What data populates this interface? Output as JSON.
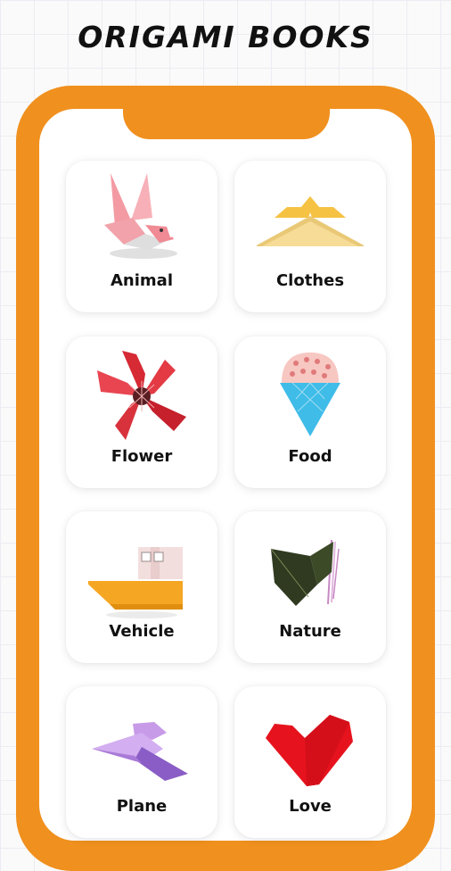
{
  "header": {
    "title": "ORIGAMI BOOKS"
  },
  "categories": [
    {
      "label": "Animal",
      "icon": "origami-bird-icon"
    },
    {
      "label": "Clothes",
      "icon": "origami-hat-icon"
    },
    {
      "label": "Flower",
      "icon": "origami-flower-icon"
    },
    {
      "label": "Food",
      "icon": "origami-icecream-icon"
    },
    {
      "label": "Vehicle",
      "icon": "origami-boat-icon"
    },
    {
      "label": "Nature",
      "icon": "origami-leaf-icon"
    },
    {
      "label": "Plane",
      "icon": "origami-plane-icon"
    },
    {
      "label": "Love",
      "icon": "origami-heart-icon"
    }
  ],
  "colors": {
    "frame": "#f0901e",
    "background": "#fafafa"
  }
}
